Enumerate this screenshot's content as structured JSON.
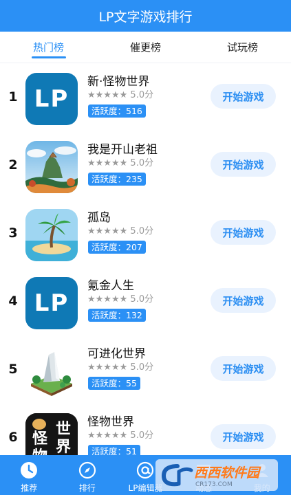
{
  "header": {
    "title": "LP文字游戏排行"
  },
  "tabs": [
    {
      "label": "热门榜",
      "active": true
    },
    {
      "label": "催更榜",
      "active": false
    },
    {
      "label": "试玩榜",
      "active": false
    }
  ],
  "games": [
    {
      "rank": "1",
      "name": "新·怪物世界",
      "stars": "★★★★★",
      "score": "5.0分",
      "activity": "活跃度：516",
      "button": "开始游戏",
      "icon": "lp-logo-icon"
    },
    {
      "rank": "2",
      "name": "我是开山老祖",
      "stars": "★★★★★",
      "score": "5.0分",
      "activity": "活跃度：235",
      "button": "开始游戏",
      "icon": "mountain-painting-icon"
    },
    {
      "rank": "3",
      "name": "孤岛",
      "stars": "★★★★★",
      "score": "5.0分",
      "activity": "活跃度：207",
      "button": "开始游戏",
      "icon": "palm-island-icon"
    },
    {
      "rank": "4",
      "name": "氪金人生",
      "stars": "★★★★★",
      "score": "5.0分",
      "activity": "活跃度：132",
      "button": "开始游戏",
      "icon": "lp-logo-icon"
    },
    {
      "rank": "5",
      "name": "可进化世界",
      "stars": "★★★★★",
      "score": "5.0分",
      "activity": "活跃度：55",
      "button": "开始游戏",
      "icon": "crystal-world-icon"
    },
    {
      "rank": "6",
      "name": "怪物世界",
      "stars": "★★★★★",
      "score": "5.0分",
      "activity": "活跃度：51",
      "button": "开始游戏",
      "icon": "monster-world-text-icon"
    }
  ],
  "icon_text": {
    "lp": "LP",
    "monster_1": "世",
    "monster_2": "界",
    "monster_3": "怪",
    "monster_4": "物"
  },
  "bottom_nav": [
    {
      "label": "推荐",
      "icon": "clock-icon"
    },
    {
      "label": "排行",
      "icon": "compass-icon"
    },
    {
      "label": "LP编辑器",
      "icon": "at-icon"
    },
    {
      "label": "动态",
      "icon": "chat-icon"
    },
    {
      "label": "我的",
      "icon": "user-icon"
    }
  ],
  "watermark": {
    "main": "西西软件园",
    "sub": "CR173.COM"
  },
  "colors": {
    "primary": "#2b90f5",
    "button_bg": "#e9f2fe",
    "lp_icon_bg": "#0f79b5"
  }
}
